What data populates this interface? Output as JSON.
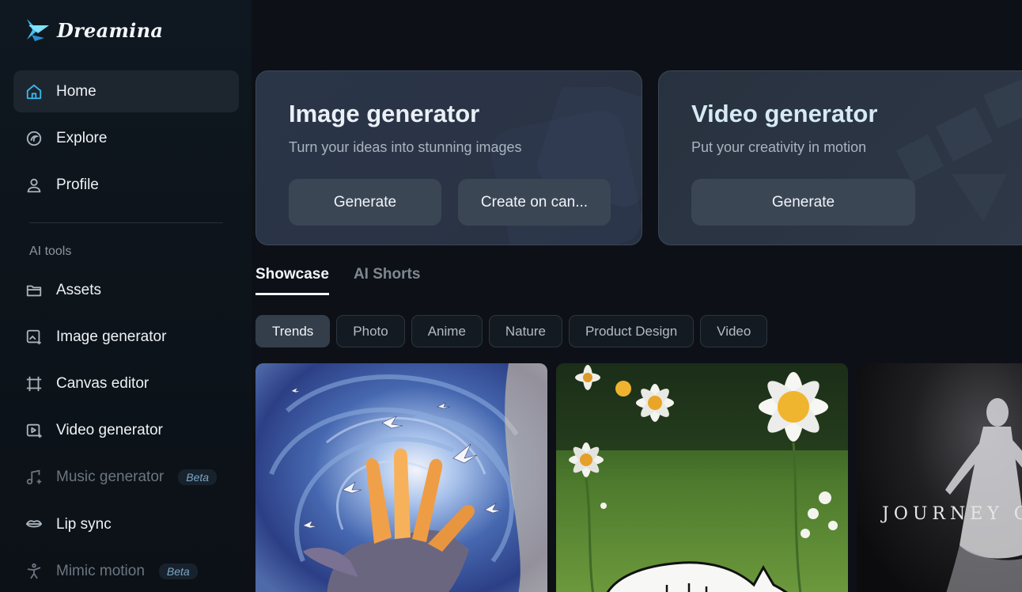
{
  "app": {
    "name": "Dreamina"
  },
  "sidebar": {
    "top_items": [
      {
        "label": "Home",
        "icon": "home-icon",
        "active": true
      },
      {
        "label": "Explore",
        "icon": "explore-icon"
      },
      {
        "label": "Profile",
        "icon": "profile-icon"
      }
    ],
    "section_label": "AI tools",
    "tool_items": [
      {
        "label": "Assets",
        "icon": "folder-icon"
      },
      {
        "label": "Image generator",
        "icon": "image-generator-icon"
      },
      {
        "label": "Canvas editor",
        "icon": "canvas-icon"
      },
      {
        "label": "Video generator",
        "icon": "video-generator-icon"
      },
      {
        "label": "Music generator",
        "icon": "music-icon",
        "badge": "Beta",
        "dimmed": true
      },
      {
        "label": "Lip sync",
        "icon": "lip-sync-icon"
      },
      {
        "label": "Mimic motion",
        "icon": "mimic-motion-icon",
        "badge": "Beta",
        "dimmed": true
      }
    ]
  },
  "cards": {
    "image": {
      "title": "Image generator",
      "subtitle": "Turn your ideas into stunning images",
      "generate_label": "Generate",
      "canvas_label": "Create on can..."
    },
    "video": {
      "title": "Video generator",
      "subtitle": "Put your creativity in motion",
      "generate_label": "Generate"
    }
  },
  "tabs": [
    {
      "label": "Showcase",
      "active": true
    },
    {
      "label": "AI Shorts",
      "active": false
    }
  ],
  "filters": [
    {
      "label": "Trends",
      "active": true
    },
    {
      "label": "Photo"
    },
    {
      "label": "Anime"
    },
    {
      "label": "Nature"
    },
    {
      "label": "Product Design"
    },
    {
      "label": "Video"
    }
  ],
  "thumbnails": {
    "third_caption": "JOURNEY O"
  },
  "colors": {
    "background": "#0d1117",
    "sidebar_active": "#1d262f",
    "card_button": "#3b4655",
    "accent_logo": "#3fb7e8"
  }
}
